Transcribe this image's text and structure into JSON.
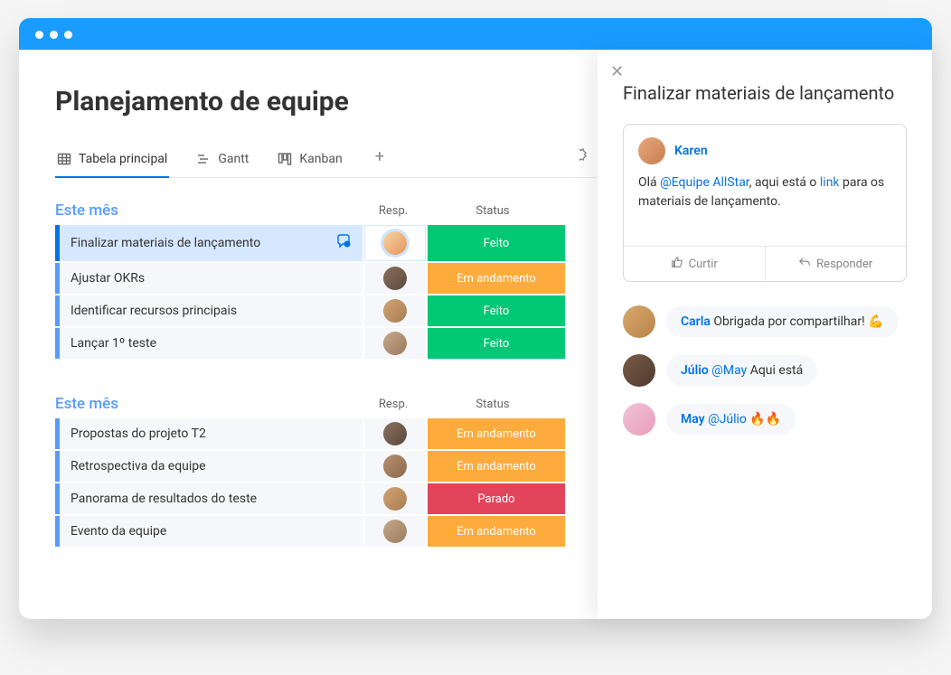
{
  "page": {
    "title": "Planejamento de equipe"
  },
  "tabs": [
    {
      "label": "Tabela principal",
      "active": true
    },
    {
      "label": "Gantt",
      "active": false
    },
    {
      "label": "Kanban",
      "active": false
    }
  ],
  "columns": {
    "resp": "Resp.",
    "status": "Status"
  },
  "groups": [
    {
      "title": "Este mês",
      "rows": [
        {
          "task": "Finalizar materiais de lançamento",
          "status": "Feito",
          "status_class": "status-feito",
          "selected": true,
          "has_chat": true,
          "avatar": "av1"
        },
        {
          "task": "Ajustar OKRs",
          "status": "Em andamento",
          "status_class": "status-andamento",
          "selected": false,
          "has_chat": false,
          "avatar": "av2"
        },
        {
          "task": "Identificar recursos principais",
          "status": "Feito",
          "status_class": "status-feito",
          "selected": false,
          "has_chat": false,
          "avatar": "av3"
        },
        {
          "task": "Lançar 1º teste",
          "status": "Feito",
          "status_class": "status-feito",
          "selected": false,
          "has_chat": false,
          "avatar": "av4"
        }
      ]
    },
    {
      "title": "Este mês",
      "rows": [
        {
          "task": "Propostas do projeto T2",
          "status": "Em andamento",
          "status_class": "status-andamento",
          "selected": false,
          "has_chat": false,
          "avatar": "av2"
        },
        {
          "task": "Retrospectiva da equipe",
          "status": "Em andamento",
          "status_class": "status-andamento",
          "selected": false,
          "has_chat": false,
          "avatar": "av5"
        },
        {
          "task": "Panorama de resultados do teste",
          "status": "Parado",
          "status_class": "status-parado",
          "selected": false,
          "has_chat": false,
          "avatar": "av3"
        },
        {
          "task": "Evento da equipe",
          "status": "Em andamento",
          "status_class": "status-andamento",
          "selected": false,
          "has_chat": false,
          "avatar": "av4"
        }
      ]
    }
  ],
  "side": {
    "title": "Finalizar materiais de lançamento",
    "comment": {
      "author": "Karen",
      "text_prefix": "Olá ",
      "mention": "@Equipe AllStar",
      "text_mid": ", aqui está o  ",
      "link": "link",
      "text_suffix": " para os materiais de lançamento."
    },
    "actions": {
      "like": "Curtir",
      "reply": "Responder"
    },
    "replies": [
      {
        "author": "Carla",
        "text": " Obrigada por compartilhar! 💪",
        "avatar": "av-carla",
        "mention": ""
      },
      {
        "author": "Júlio",
        "text": " Aqui está",
        "avatar": "av-julio",
        "mention": "@May"
      },
      {
        "author": "May",
        "text": " 🔥🔥",
        "avatar": "av-may",
        "mention": "@Júlio"
      }
    ]
  }
}
